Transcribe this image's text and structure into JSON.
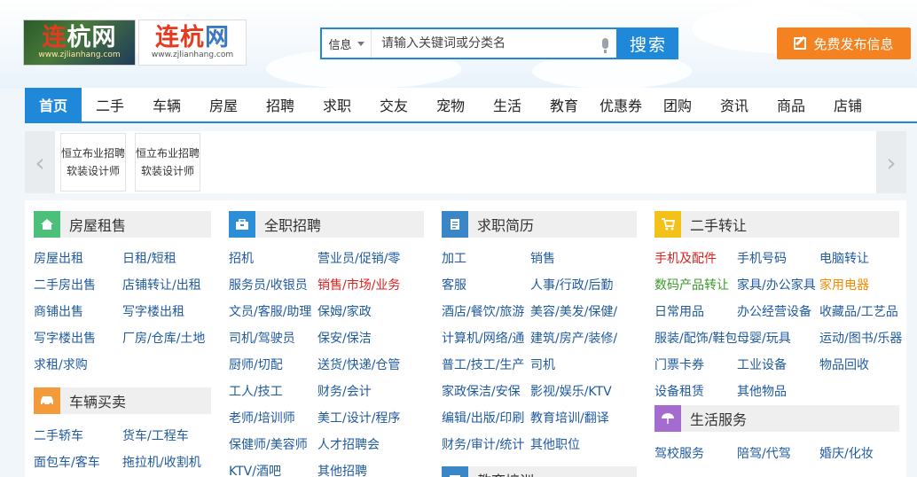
{
  "header": {
    "logo1": {
      "main_a": "连",
      "main_b": "杭网",
      "sub": "www.zjlianhang.com"
    },
    "logo2": {
      "main_a": "连杭",
      "main_b": "网",
      "sub": "www.zjlianhang.com"
    },
    "search": {
      "category": "信息",
      "placeholder": "请输入关键词或分类名",
      "button": "搜索"
    },
    "publish_button": "免费发布信息"
  },
  "nav": [
    "首页",
    "二手",
    "车辆",
    "房屋",
    "招聘",
    "求职",
    "交友",
    "宠物",
    "生活",
    "教育",
    "优惠券",
    "团购",
    "资讯",
    "商品",
    "店铺"
  ],
  "ads": [
    {
      "line1": "恒立布业招聘",
      "line2": "软装设计师"
    },
    {
      "line1": "恒立布业招聘",
      "line2": "软装设计师"
    }
  ],
  "sections": {
    "house": {
      "title": "房屋租售",
      "links": [
        "房屋出租",
        "日租/短租",
        "二手房出售",
        "店铺转让/出租",
        "商铺出售",
        "写字楼出租",
        "写字楼出售",
        "厂房/仓库/土地",
        "求租/求购"
      ]
    },
    "car": {
      "title": "车辆买卖",
      "links": [
        "二手轿车",
        "货车/工程车",
        "面包车/客车",
        "拖拉机/收割机"
      ]
    },
    "job": {
      "title": "全职招聘",
      "links": [
        "招机",
        "营业员/促销/零",
        "服务员/收银员",
        "销售/市场/业务",
        "文员/客服/助理",
        "保姆/家政",
        "司机/驾驶员",
        "保安/保洁",
        "厨师/切配",
        "送货/快递/仓管",
        "工人/技工",
        "财务/会计",
        "老师/培训师",
        "美工/设计/程序",
        "保健师/美容师",
        "人才招聘会",
        "KTV/酒吧",
        "其他招聘"
      ]
    },
    "resume": {
      "title": "求职简历",
      "links": [
        "加工",
        "销售",
        "客服",
        "人事/行政/后勤",
        "酒店/餐饮/旅游",
        "美容/美发/保健/",
        "计算机/网络/通",
        "建筑/房产/装修/",
        "普工/技工/生产",
        "司机",
        "家政保洁/安保",
        "影视/娱乐/KTV",
        "编辑/出版/印刷",
        "教育培训/翻译",
        "财务/审计/统计",
        "其他职位"
      ]
    },
    "edu": {
      "title": "教育培训"
    },
    "second": {
      "title": "二手转让",
      "links": [
        "手机及配件",
        "手机号码",
        "电脑转让",
        "数码产品转让",
        "家具/办公家具",
        "家用电器",
        "日常用品",
        "办公经营设备",
        "收藏品/工艺品",
        "服装/配饰/鞋包",
        "母婴/玩具",
        "运动/图书/乐器",
        "门票卡券",
        "工业设备",
        "物品回收",
        "设备租赁",
        "其他物品"
      ]
    },
    "life": {
      "title": "生活服务",
      "links": [
        "驾校服务",
        "陪驾/代驾",
        "婚庆/化妆"
      ]
    }
  },
  "colors": {
    "primary": "#1f88d8",
    "orange": "#f58220",
    "link": "#1f5aa0",
    "house_icon": "#4cc07a",
    "car_icon": "#f39a3a",
    "job_icon": "#2d8ed8",
    "resume_icon": "#3b86c6",
    "second_icon": "#f2c21a",
    "life_icon": "#a56ccf",
    "edu_icon": "#3b86c6"
  }
}
